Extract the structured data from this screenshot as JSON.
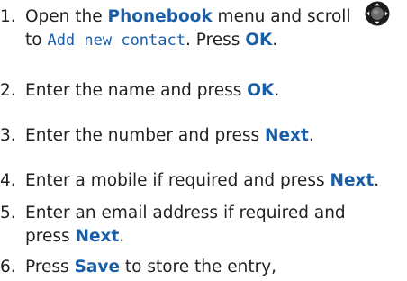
{
  "steps": [
    {
      "number": "1.",
      "line1_a": "Open the ",
      "line1_kw": "Phonebook",
      "line1_b": " menu and scroll",
      "line2_a": "to ",
      "line2_screen": "Add new contact",
      "line2_b": ". Press ",
      "line2_kw": "OK",
      "line2_c": "."
    },
    {
      "number": "2.",
      "text_a": "Enter the name and press ",
      "kw": "OK",
      "text_b": "."
    },
    {
      "number": "3.",
      "text_a": "Enter the number and press ",
      "kw": "Next",
      "text_b": "."
    },
    {
      "number": "4.",
      "text_a": "Enter a mobile if required and press ",
      "kw": "Next",
      "text_b": "."
    },
    {
      "number": "5.",
      "line1": "Enter an email address if required and",
      "line2_a": "press ",
      "line2_kw": "Next",
      "line2_b": "."
    },
    {
      "number": "6.",
      "text_a": "Press ",
      "kw": "Save",
      "text_b": " to store the entry,"
    }
  ],
  "icons": {
    "nav_key": "navigation-key-icon"
  },
  "colors": {
    "text": "#231f20",
    "keyword": "#1a5ea8"
  }
}
